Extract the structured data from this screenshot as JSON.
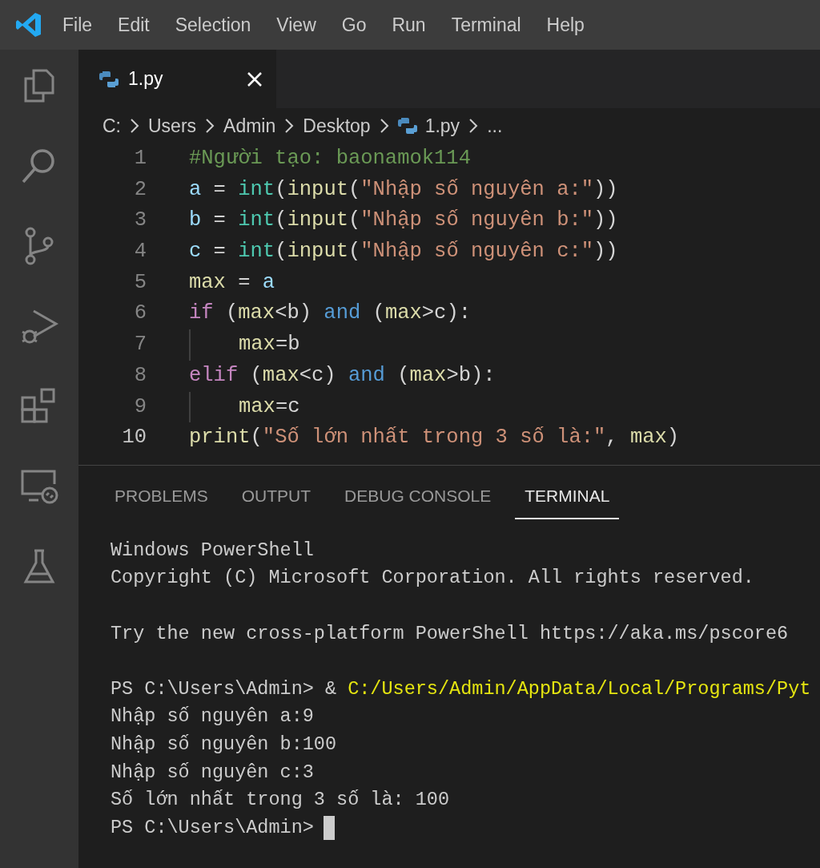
{
  "menu": [
    "File",
    "Edit",
    "Selection",
    "View",
    "Go",
    "Run",
    "Terminal",
    "Help"
  ],
  "tabs": [
    {
      "label": "1.py",
      "selected": true
    }
  ],
  "breadcrumb": [
    {
      "label": "C:",
      "kind": "folder"
    },
    {
      "label": "Users",
      "kind": "folder"
    },
    {
      "label": "Admin",
      "kind": "folder"
    },
    {
      "label": "Desktop",
      "kind": "folder"
    },
    {
      "label": "1.py",
      "kind": "file"
    },
    {
      "label": "...",
      "kind": "more"
    }
  ],
  "code": [
    {
      "number": "1",
      "indented": false,
      "tokens": [
        {
          "text": "#Người tạo: baonamok114",
          "kind": "comment"
        }
      ]
    },
    {
      "number": "2",
      "indented": false,
      "tokens": [
        {
          "text": "a",
          "kind": "variable"
        },
        {
          "text": " = ",
          "kind": "plain"
        },
        {
          "text": "int",
          "kind": "type"
        },
        {
          "text": "(",
          "kind": "plain"
        },
        {
          "text": "input",
          "kind": "function"
        },
        {
          "text": "(",
          "kind": "plain"
        },
        {
          "text": "\"Nhập số nguyên a:\"",
          "kind": "string"
        },
        {
          "text": "))",
          "kind": "plain"
        }
      ]
    },
    {
      "number": "3",
      "indented": false,
      "tokens": [
        {
          "text": "b",
          "kind": "variable"
        },
        {
          "text": " = ",
          "kind": "plain"
        },
        {
          "text": "int",
          "kind": "type"
        },
        {
          "text": "(",
          "kind": "plain"
        },
        {
          "text": "input",
          "kind": "function"
        },
        {
          "text": "(",
          "kind": "plain"
        },
        {
          "text": "\"Nhập số nguyên b:\"",
          "kind": "string"
        },
        {
          "text": "))",
          "kind": "plain"
        }
      ]
    },
    {
      "number": "4",
      "indented": false,
      "tokens": [
        {
          "text": "c",
          "kind": "variable"
        },
        {
          "text": " = ",
          "kind": "plain"
        },
        {
          "text": "int",
          "kind": "type"
        },
        {
          "text": "(",
          "kind": "plain"
        },
        {
          "text": "input",
          "kind": "function"
        },
        {
          "text": "(",
          "kind": "plain"
        },
        {
          "text": "\"Nhập số nguyên c:\"",
          "kind": "string"
        },
        {
          "text": "))",
          "kind": "plain"
        }
      ]
    },
    {
      "number": "5",
      "indented": false,
      "tokens": [
        {
          "text": "max",
          "kind": "function"
        },
        {
          "text": " = ",
          "kind": "plain"
        },
        {
          "text": "a",
          "kind": "variable"
        }
      ]
    },
    {
      "number": "6",
      "indented": false,
      "tokens": [
        {
          "text": "if",
          "kind": "control"
        },
        {
          "text": " (",
          "kind": "plain"
        },
        {
          "text": "max",
          "kind": "function"
        },
        {
          "text": "<b) ",
          "kind": "plain"
        },
        {
          "text": "and",
          "kind": "keyword"
        },
        {
          "text": " (",
          "kind": "plain"
        },
        {
          "text": "max",
          "kind": "function"
        },
        {
          "text": ">c):",
          "kind": "plain"
        }
      ]
    },
    {
      "number": "7",
      "indented": true,
      "tokens": [
        {
          "text": "max",
          "kind": "function"
        },
        {
          "text": "=b",
          "kind": "plain"
        }
      ]
    },
    {
      "number": "8",
      "indented": false,
      "tokens": [
        {
          "text": "elif",
          "kind": "control"
        },
        {
          "text": " (",
          "kind": "plain"
        },
        {
          "text": "max",
          "kind": "function"
        },
        {
          "text": "<c) ",
          "kind": "plain"
        },
        {
          "text": "and",
          "kind": "keyword"
        },
        {
          "text": " (",
          "kind": "plain"
        },
        {
          "text": "max",
          "kind": "function"
        },
        {
          "text": ">b):",
          "kind": "plain"
        }
      ]
    },
    {
      "number": "9",
      "indented": true,
      "tokens": [
        {
          "text": "max",
          "kind": "function"
        },
        {
          "text": "=c",
          "kind": "plain"
        }
      ]
    },
    {
      "number": "10",
      "indented": false,
      "tokens": [
        {
          "text": "print",
          "kind": "function"
        },
        {
          "text": "(",
          "kind": "plain"
        },
        {
          "text": "\"Số lớn nhất trong 3 số là:\"",
          "kind": "string"
        },
        {
          "text": ", ",
          "kind": "plain"
        },
        {
          "text": "max",
          "kind": "function"
        },
        {
          "text": ")",
          "kind": "plain"
        }
      ]
    }
  ],
  "panel_tabs": [
    {
      "label": "PROBLEMS",
      "selected": false
    },
    {
      "label": "OUTPUT",
      "selected": false
    },
    {
      "label": "DEBUG CONSOLE",
      "selected": false
    },
    {
      "label": "TERMINAL",
      "selected": true
    }
  ],
  "terminal": [
    {
      "kind": "text",
      "parts": [
        {
          "text": "Windows PowerShell",
          "kind": "plain"
        }
      ]
    },
    {
      "kind": "text",
      "parts": [
        {
          "text": "Copyright (C) Microsoft Corporation. All rights reserved.",
          "kind": "plain"
        }
      ]
    },
    {
      "kind": "blank"
    },
    {
      "kind": "text",
      "parts": [
        {
          "text": "Try the new cross-platform PowerShell https://aka.ms/pscore6",
          "kind": "plain"
        }
      ]
    },
    {
      "kind": "blank"
    },
    {
      "kind": "text",
      "parts": [
        {
          "text": "PS C:\\Users\\Admin> & ",
          "kind": "plain"
        },
        {
          "text": "C:/Users/Admin/AppData/Local/Programs/Pyt",
          "kind": "command"
        }
      ]
    },
    {
      "kind": "text",
      "parts": [
        {
          "text": "Nhập số nguyên a:9",
          "kind": "plain"
        }
      ]
    },
    {
      "kind": "text",
      "parts": [
        {
          "text": "Nhập số nguyên b:100",
          "kind": "plain"
        }
      ]
    },
    {
      "kind": "text",
      "parts": [
        {
          "text": "Nhập số nguyên c:3",
          "kind": "plain"
        }
      ]
    },
    {
      "kind": "text",
      "parts": [
        {
          "text": "Số lớn nhất trong 3 số là: 100",
          "kind": "plain"
        }
      ]
    },
    {
      "kind": "prompt",
      "parts": [
        {
          "text": "PS C:\\Users\\Admin>",
          "kind": "plain"
        }
      ]
    }
  ]
}
